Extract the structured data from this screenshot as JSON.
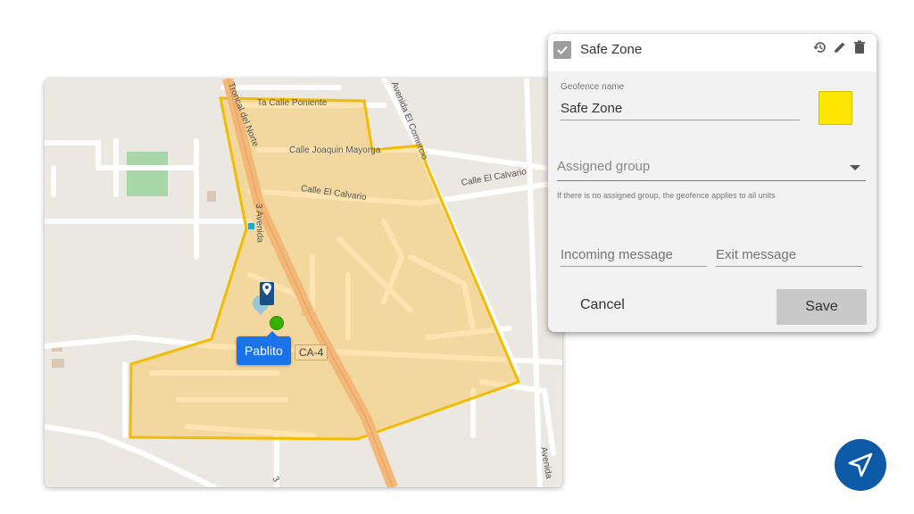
{
  "map": {
    "streets": {
      "ta_calle_poniente": "Ta Calle Poniente",
      "calle_joaquin_mayorga": "Calle Joaquin Mayorga",
      "calle_el_calvario": "Calle El Calvario",
      "calle_el_calvario_east": "Calle El Calvario",
      "avenida_el_comercio": "Avenida El Comercio",
      "troncal_del_norte": "Troncal del Norte",
      "tercera_avenida": "3 Avenida",
      "avenida_bottom": "Avenida",
      "bottom_three": "3"
    },
    "road_shield": "CA-4",
    "unit_name": "Pablito",
    "geofence_color": "#f4c20d"
  },
  "panel": {
    "title": "Safe Zone",
    "geofence_name_label": "Geofence name",
    "geofence_name_value": "Safe Zone",
    "color": "#ffe600",
    "assigned_group_placeholder": "Assigned group",
    "assigned_group_hint": "If there is no assigned group, the geofence applies to all units",
    "incoming_message_placeholder": "Incoming message",
    "exit_message_placeholder": "Exit message",
    "cancel_label": "Cancel",
    "save_label": "Save",
    "icons": [
      "history-icon",
      "edit-icon",
      "delete-icon"
    ]
  },
  "logo": {
    "icon": "navigation-arrow-icon",
    "color": "#0d5aa7"
  }
}
